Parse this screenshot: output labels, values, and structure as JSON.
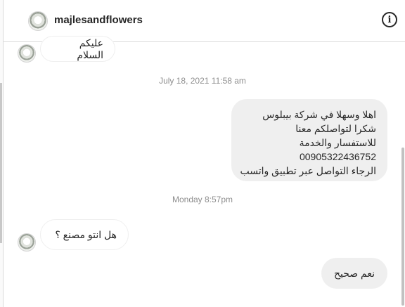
{
  "header": {
    "username": "majlesandflowers"
  },
  "timestamps": [
    "July 18, 2021 11:58 am",
    "Monday 8:57pm"
  ],
  "messages": {
    "m1": "عليكم السلام",
    "m2": [
      "اهلا وسهلا في شركة بيبلوس",
      "شكرا لتواصلكم معنا",
      "للاستفسار والخدمة",
      "00905322436752",
      "الرجاء التواصل عبر تطبيق واتسب"
    ],
    "m3": "هل انتو مصنع ؟",
    "m4": "نعم صحيح"
  },
  "icons": {
    "info": "info-icon"
  }
}
